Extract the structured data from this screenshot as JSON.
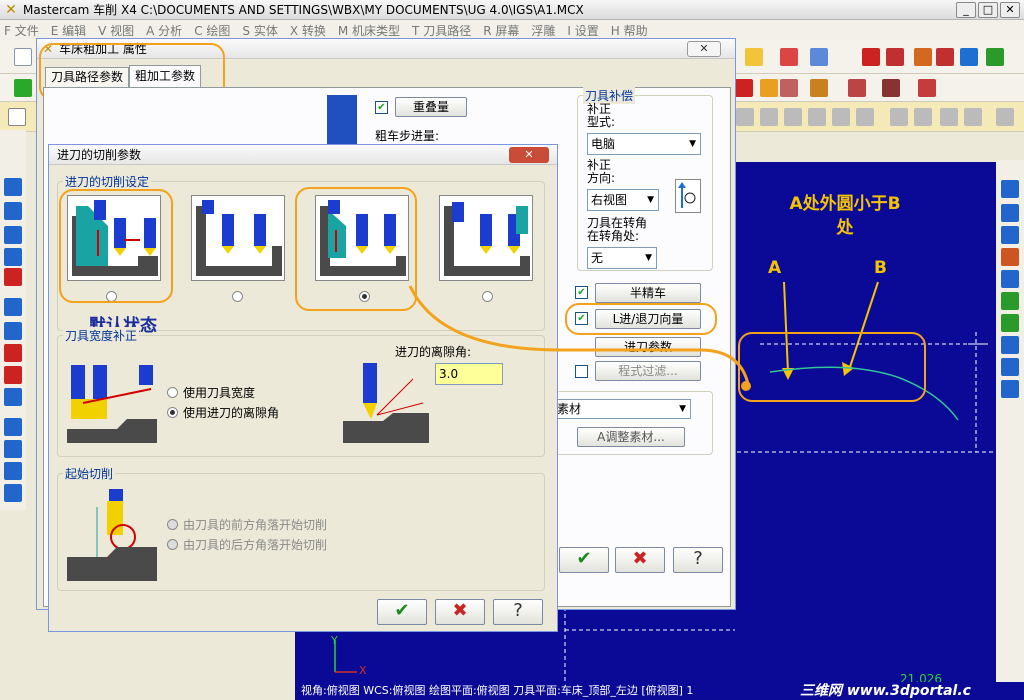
{
  "app": {
    "title": "Mastercam 车削  X4  C:\\DOCUMENTS AND SETTINGS\\WBX\\MY DOCUMENTS\\UG 4.0\\IGS\\A1.MCX",
    "min": "_",
    "max": "□",
    "close": "✕"
  },
  "menu": [
    "F 文件",
    "E 编辑",
    "V 视图",
    "A 分析",
    "C 绘图",
    "S 实体",
    "X 转换",
    "M 机床类型",
    "T 刀具路径",
    "R 屏幕",
    "浮雕",
    "I 设置",
    "H 帮助"
  ],
  "back_dialog": {
    "title": "车床粗加工 属性",
    "tabs": [
      "刀具路径参数",
      "粗加工参数"
    ],
    "overlap_label": "重叠量",
    "step_label": "粗车步进量:",
    "tool_comp": {
      "group": "刀具补偿",
      "type_label": "补正\n型式:",
      "type_value": "电脑",
      "dir_label": "补正\n方向:",
      "dir_value": "右视图",
      "corner_label": "刀具在转角\n在转角处:",
      "corner_value": "无"
    },
    "semi_finish": "半精车",
    "entry_exit": "L进/退刀向量",
    "plunge": "进刀参数",
    "filter": "程式过滤...",
    "stock_value": "素材",
    "adjust_stock": "A调整素材..."
  },
  "front_dialog": {
    "title": "进刀的切削参数",
    "close": "✕",
    "group1": "进刀的切削设定",
    "selected_index": 2,
    "default_note": "默认状态",
    "group2": "刀具宽度补正",
    "opt_tool_width": "使用刀具宽度",
    "opt_clearance": "使用进刀的离隙角",
    "clearance_label": "进刀的离隙角:",
    "clearance_value": "3.0",
    "group3": "起始切削",
    "start_front": "由刀具的前方角落开始切削",
    "start_back": "由刀具的后方角落开始切削"
  },
  "buttons": {
    "ok": "✔",
    "cancel": "✖",
    "help": "?"
  },
  "annotation": {
    "title": "A处外圆小于B\n处",
    "label_a": "A",
    "label_b": "B"
  },
  "axis": {
    "y": "Y",
    "x": "X"
  },
  "coord": "21.026",
  "status": "视角:俯视图   WCS:俯视图   绘图平面:俯视图   刀具平面:车床_顶部_左边 [俯视图] 1",
  "watermark": "三维网 www.3dportal.c",
  "colors": {
    "graphics_bg": "#0a0a96",
    "highlight": "#f2a21c",
    "annotation_text": "#f5c400"
  }
}
